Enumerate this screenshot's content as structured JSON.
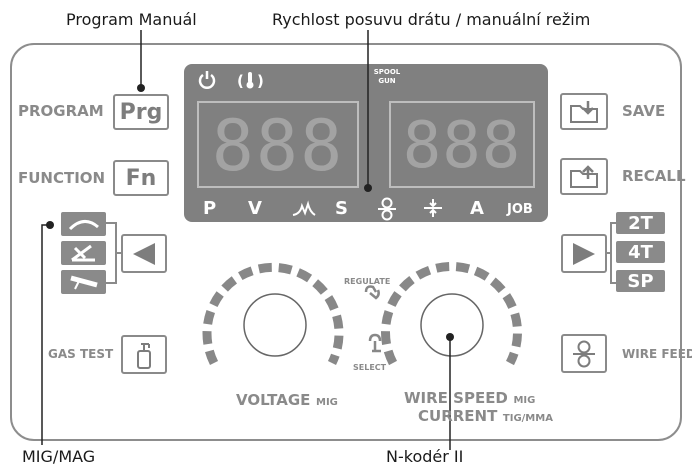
{
  "annotations": {
    "program_manual": "Program Manuál",
    "wire_speed_manual": "Rychlost posuvu drátu / manuální režim",
    "mig_mag": "MIG/MAG",
    "encoder": "N-kodér II"
  },
  "left_labels": {
    "program": "PROGRAM",
    "function": "FUNCTION",
    "gas_test": "GAS TEST"
  },
  "right_labels": {
    "save": "SAVE",
    "recall": "RECALL",
    "wire_feed": "WIRE FEED"
  },
  "buttons": {
    "prg": "Prg",
    "fn": "Fn"
  },
  "display": {
    "spool_gun": "SPOOL GUN",
    "left_digits": "888",
    "right_digits": "888",
    "indicators": [
      "P",
      "V",
      "S",
      "A",
      "JOB"
    ]
  },
  "modes_right": [
    "2T",
    "4T",
    "SP"
  ],
  "knobs": {
    "regulate": "REGULATE",
    "select": "SELECT",
    "voltage": "VOLTAGE",
    "voltage_suffix": "MIG",
    "wire_speed": "WIRE SPEED",
    "wire_speed_suffix": "MIG",
    "current": "CURRENT",
    "current_suffix": "TIG/MMA"
  },
  "icons": [
    "power-icon",
    "thermal-icon",
    "arc-icon",
    "wire-feed-icon",
    "inductance-icon",
    "save-icon",
    "recall-icon",
    "gas-bottle-icon",
    "left-arrow-icon",
    "right-arrow-icon",
    "mig-torch-icon",
    "tig-torch-icon",
    "mma-holder-icon"
  ]
}
